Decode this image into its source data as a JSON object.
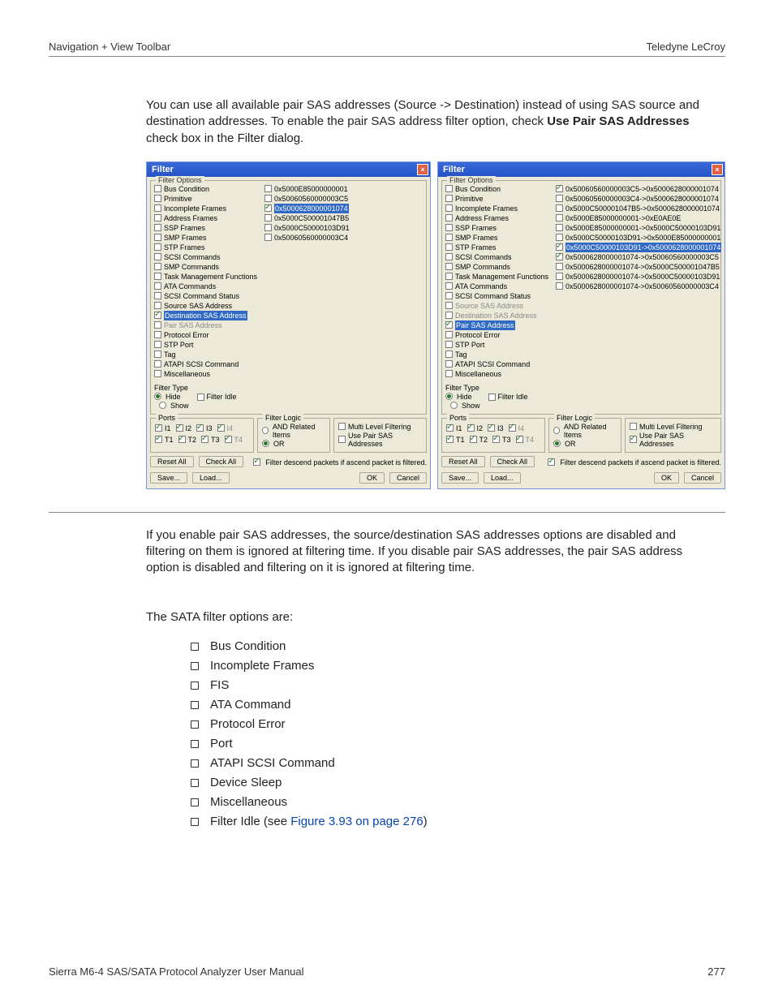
{
  "header": {
    "left": "Navigation + View Toolbar",
    "right": "Teledyne LeCroy"
  },
  "para1_a": "You can use all available pair SAS addresses (Source -> Destination) instead of using SAS source and destination addresses. To enable the pair SAS address filter option, check ",
  "para1_b": "Use Pair SAS Addresses",
  "para1_c": " check box in the Filter dialog.",
  "para2": "If you enable pair SAS addresses, the source/destination SAS addresses options are disabled and filtering on them is ignored at filtering time. If you disable pair SAS addresses, the pair SAS address option is disabled and filtering on it is ignored at filtering time.",
  "sata_intro": "The SATA filter options are:",
  "sata_items": [
    "Bus Condition",
    "Incomplete Frames",
    "FIS",
    "ATA Command",
    "Protocol Error",
    "Port",
    "ATAPI SCSI Command",
    "Device Sleep",
    "Miscellaneous"
  ],
  "sata_last_a": "Filter Idle (see ",
  "sata_last_link": "Figure 3.93 on page 276",
  "sata_last_b": ")",
  "dlg": {
    "title": "Filter",
    "group_filter_options": "Filter Options",
    "tree": [
      "Bus Condition",
      "Primitive",
      "Incomplete Frames",
      "Address Frames",
      "SSP Frames",
      "SMP Frames",
      "STP Frames",
      "SCSI Commands",
      "SMP Commands",
      "Task Management Functions",
      "ATA Commands",
      "SCSI Command Status",
      "Source SAS Address",
      "Destination SAS Address",
      "Pair SAS Address",
      "Protocol Error",
      "STP Port",
      "Tag",
      "ATAPI SCSI Command",
      "Miscellaneous"
    ],
    "left_addrs": [
      {
        "t": "0x5000E85000000001",
        "c": false
      },
      {
        "t": "0x50060560000003C5",
        "c": false
      },
      {
        "t": "0x5000628000001074",
        "c": true,
        "hl": true
      },
      {
        "t": "0x5000C500001047B5",
        "c": false
      },
      {
        "t": "0x5000C50000103D91",
        "c": false
      },
      {
        "t": "0x50060560000003C4",
        "c": false
      }
    ],
    "right_addrs": [
      {
        "t": "0x50060560000003C5->0x5000628000001074",
        "c": true
      },
      {
        "t": "0x50060560000003C4->0x5000628000001074",
        "c": false
      },
      {
        "t": "0x5000C500001047B5->0x5000628000001074",
        "c": false
      },
      {
        "t": "0x5000E85000000001->0xE0AE0E",
        "c": false
      },
      {
        "t": "0x5000E85000000001->0x5000C50000103D91",
        "c": false
      },
      {
        "t": "0x5000C50000103D91->0x5000E85000000001",
        "c": false
      },
      {
        "t": "0x5000C50000103D91->0x5000628000001074",
        "c": true,
        "hl": true
      },
      {
        "t": "0x5000628000001074->0x50060560000003C5",
        "c": true
      },
      {
        "t": "0x5000628000001074->0x5000C500001047B5",
        "c": false
      },
      {
        "t": "0x5000628000001074->0x5000C50000103D91",
        "c": false
      },
      {
        "t": "0x5000628000001074->0x50060560000003C4",
        "c": false
      }
    ],
    "filter_type": "Filter Type",
    "hide": "Hide",
    "show": "Show",
    "filter_idle": "Filter Idle",
    "ports": "Ports",
    "I": [
      "I1",
      "I2",
      "I3",
      "I4"
    ],
    "T": [
      "T1",
      "T2",
      "T3",
      "T4"
    ],
    "filter_logic": "Filter Logic",
    "and": "AND Related Items",
    "or": "OR",
    "mlf": "Multi Level Filtering",
    "upsa": "Use Pair SAS Addresses",
    "descend": "Filter descend packets if ascend packet is filtered.",
    "reset": "Reset All",
    "check": "Check All",
    "save": "Save...",
    "load": "Load...",
    "ok": "OK",
    "cancel": "Cancel"
  },
  "footer": {
    "left": "Sierra M6-4 SAS/SATA Protocol Analyzer User Manual",
    "right": "277"
  }
}
